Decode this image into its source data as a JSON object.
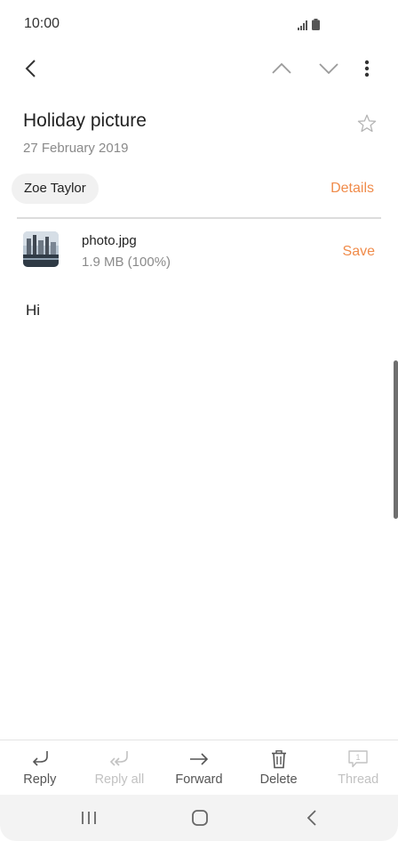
{
  "status_bar": {
    "time": "10:00"
  },
  "email": {
    "subject": "Holiday picture",
    "date": "27 February 2019",
    "sender": "Zoe Taylor",
    "details_label": "Details",
    "attachment": {
      "name": "photo.jpg",
      "size": "1.9 MB (100%)",
      "save_label": "Save"
    },
    "body": "Hi"
  },
  "toolbar": {
    "reply": "Reply",
    "reply_all": "Reply all",
    "forward": "Forward",
    "delete": "Delete",
    "thread": "Thread",
    "thread_count": "1"
  },
  "colors": {
    "accent": "#f08b4a",
    "muted": "#8a8a8a",
    "disabled": "#c2c2c2"
  },
  "icons": [
    "back-icon",
    "chevron-up-icon",
    "chevron-down-icon",
    "more-options-icon",
    "star-icon",
    "reply-icon",
    "reply-all-icon",
    "forward-icon",
    "delete-icon",
    "thread-icon",
    "recent-apps-icon",
    "home-icon",
    "nav-back-icon",
    "signal-icon",
    "battery-icon"
  ]
}
